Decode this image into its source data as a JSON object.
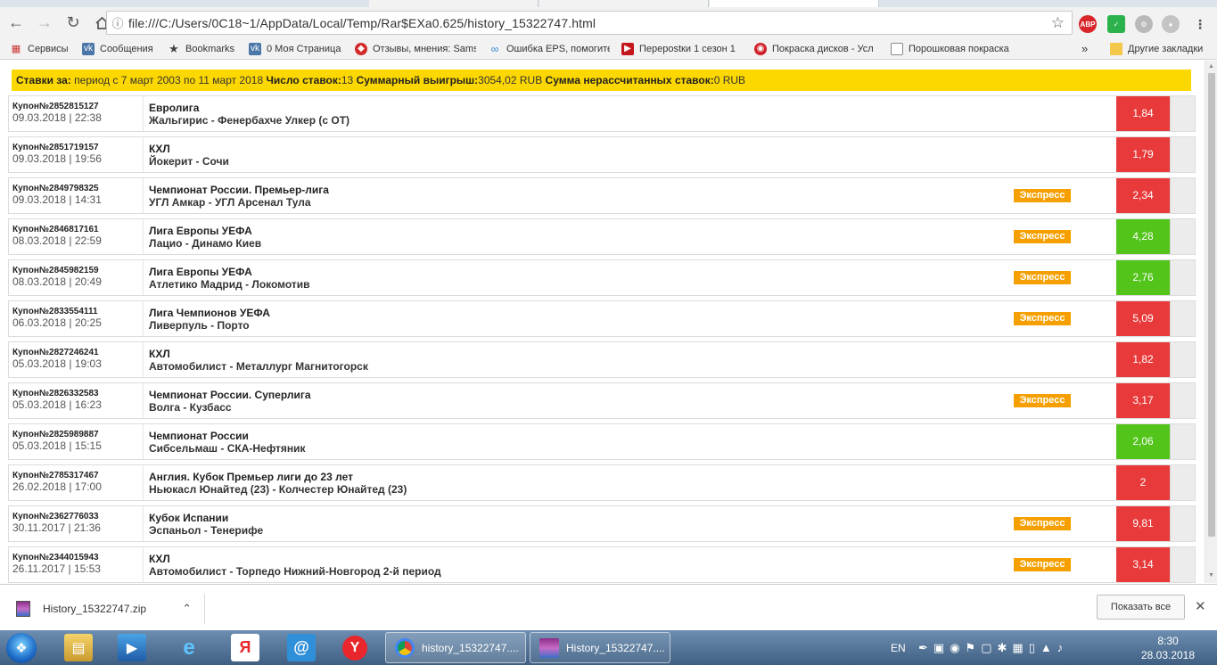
{
  "browser": {
    "url": "file:///C:/Users/0C18~1/AppData/Local/Temp/Rar$EXa0.625/history_15322747.html",
    "bookmarks": [
      {
        "label": "Сервисы",
        "icon": "apps-grid-icon"
      },
      {
        "label": "Сообщения",
        "icon": "vk-icon"
      },
      {
        "label": "Bookmarks",
        "icon": "star-icon"
      },
      {
        "label": "0 Моя Страница",
        "icon": "vk-icon"
      },
      {
        "label": "Отзывы, мнения: Sams",
        "icon": "tag-icon"
      },
      {
        "label": "Ошибка EPS, помогите",
        "icon": "bolt-icon"
      },
      {
        "label": "Перероstки 1 сезон 1",
        "icon": "youtube-icon"
      },
      {
        "label": "Покраска дисков - Усл",
        "icon": "wheel-icon"
      },
      {
        "label": "Порошковая покраска",
        "icon": "page-icon"
      }
    ],
    "bookmarks_overflow": "»",
    "other_bookmarks": "Другие закладки"
  },
  "summary": {
    "period_label": "Ставки за:",
    "period_value": "период с 7 март 2003 по 11 март 2018",
    "count_label": "Число ставок:",
    "count_value": "13",
    "win_label": "Суммарный выигрыш:",
    "win_value": "3054,02 RUB",
    "unsettled_label": "Сумма нерассчитанных ставок:",
    "unsettled_value": "0 RUB"
  },
  "colors": {
    "summary_bg": "#fdd800",
    "express": "#f5a000",
    "odds_red": "#e83a3a",
    "odds_green": "#52c41a"
  },
  "bets": [
    {
      "coupon": "Купон№2852815127",
      "date": "09.03.2018 | 22:38",
      "league": "Евролига",
      "match": "Жальгирис - Фенербахче Улкер (с ОТ)",
      "express": "",
      "odds": "1,84",
      "status": "red"
    },
    {
      "coupon": "Купон№2851719157",
      "date": "09.03.2018 | 19:56",
      "league": "КХЛ",
      "match": "Йокерит - Сочи",
      "express": "",
      "odds": "1,79",
      "status": "red"
    },
    {
      "coupon": "Купон№2849798325",
      "date": "09.03.2018 | 14:31",
      "league": "Чемпионат России. Премьер-лига",
      "match": "УГЛ Амкар - УГЛ Арсенал Тула",
      "express": "Экспресс",
      "odds": "2,34",
      "status": "red"
    },
    {
      "coupon": "Купон№2846817161",
      "date": "08.03.2018 | 22:59",
      "league": "Лига Европы УЕФА",
      "match": "Лацио - Динамо Киев",
      "express": "Экспресс",
      "odds": "4,28",
      "status": "green"
    },
    {
      "coupon": "Купон№2845982159",
      "date": "08.03.2018 | 20:49",
      "league": "Лига Европы УЕФА",
      "match": "Атлетико Мадрид - Локомотив",
      "express": "Экспресс",
      "odds": "2,76",
      "status": "green"
    },
    {
      "coupon": "Купон№2833554111",
      "date": "06.03.2018 | 20:25",
      "league": "Лига Чемпионов УЕФА",
      "match": "Ливерпуль - Порто",
      "express": "Экспресс",
      "odds": "5,09",
      "status": "red"
    },
    {
      "coupon": "Купон№2827246241",
      "date": "05.03.2018 | 19:03",
      "league": "КХЛ",
      "match": "Автомобилист - Металлург Магнитогорск",
      "express": "",
      "odds": "1,82",
      "status": "red"
    },
    {
      "coupon": "Купон№2826332583",
      "date": "05.03.2018 | 16:23",
      "league": "Чемпионат России. Суперлига",
      "match": "Волга - Кузбасс",
      "express": "Экспресс",
      "odds": "3,17",
      "status": "red"
    },
    {
      "coupon": "Купон№2825989887",
      "date": "05.03.2018 | 15:15",
      "league": "Чемпионат России",
      "match": "Сибсельмаш - СКА-Нефтяник",
      "express": "",
      "odds": "2,06",
      "status": "green"
    },
    {
      "coupon": "Купон№2785317467",
      "date": "26.02.2018 | 17:00",
      "league": "Англия. Кубок Премьер лиги до 23 лет",
      "match": "Ньюкасл Юнайтед (23) - Колчестер Юнайтед (23)",
      "express": "",
      "odds": "2",
      "status": "red"
    },
    {
      "coupon": "Купон№2362776033",
      "date": "30.11.2017 | 21:36",
      "league": "Кубок Испании",
      "match": "Эспаньол - Тенерифе",
      "express": "Экспресс",
      "odds": "9,81",
      "status": "red"
    },
    {
      "coupon": "Купон№2344015943",
      "date": "26.11.2017 | 15:53",
      "league": "КХЛ",
      "match": "Автомобилист - Торпедо Нижний-Новгород 2-й период",
      "express": "Экспресс",
      "odds": "3,14",
      "status": "red"
    }
  ],
  "downloads": {
    "file_name": "History_15322747.zip",
    "show_all": "Показать все"
  },
  "taskbar": {
    "tasks": [
      {
        "label": "history_15322747....",
        "icon": "chrome-icon"
      },
      {
        "label": "History_15322747....",
        "icon": "winrar-icon"
      }
    ],
    "yandex_label": "Я",
    "language": "EN",
    "time": "8:30",
    "date": "28.03.2018"
  }
}
